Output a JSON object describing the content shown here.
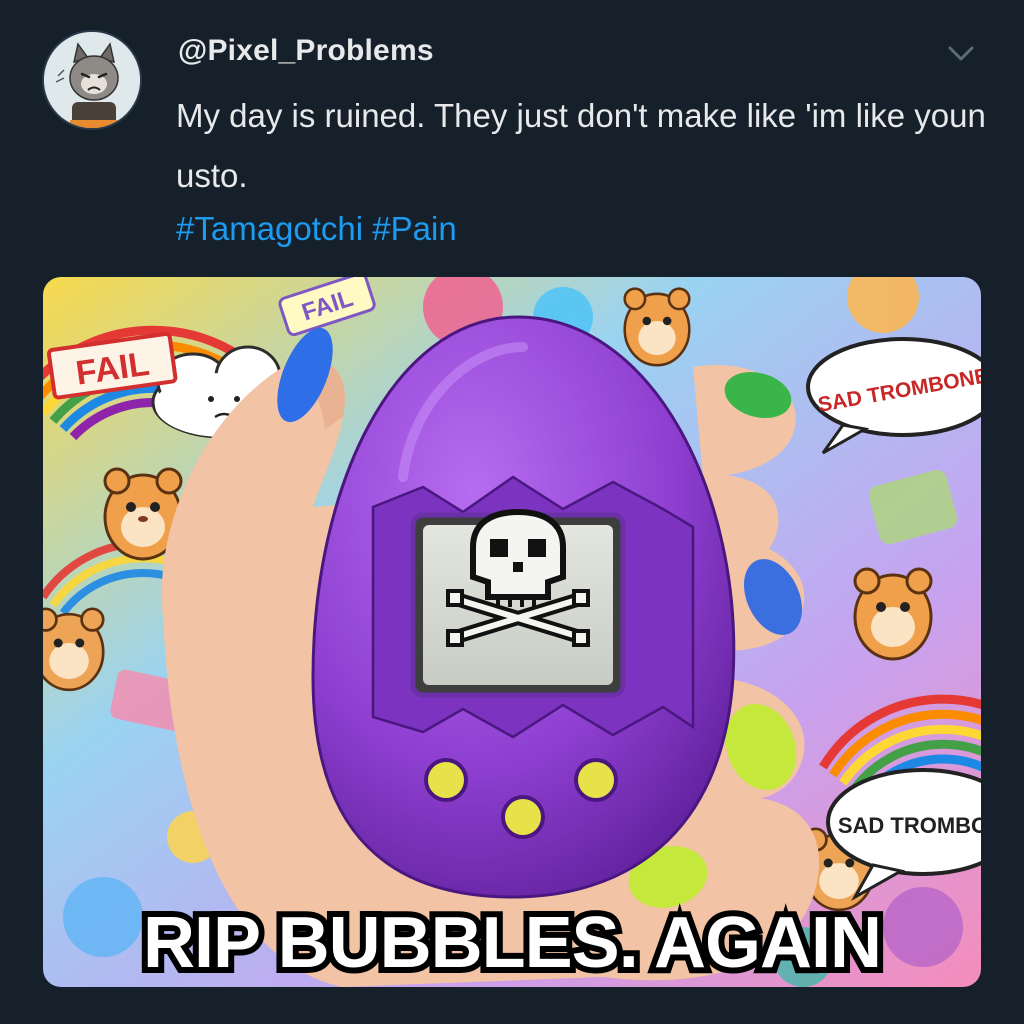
{
  "tweet": {
    "handle": "@Pixel_Problems",
    "text": "My day is ruined. They just don't make like 'im like youn usto.",
    "hashtags": [
      "#Tamagotchi",
      "#Pain"
    ]
  },
  "media": {
    "caption": "RIP BUBBLES. AGAIN",
    "stickers": {
      "fail_left": "FAIL",
      "fail_top": "FAIL",
      "sad_trombone_top": "SAD TROMBONE",
      "sad_trombone_bottom": "SAD TROMBO"
    }
  },
  "colors": {
    "background": "#15202b",
    "text": "#e7e9ea",
    "link": "#1d9bf0",
    "device": "#8e3fd0",
    "button": "#e8e24a"
  },
  "icons": {
    "menu": "chevron-down-icon",
    "screen": "skull-crossbones-icon"
  }
}
